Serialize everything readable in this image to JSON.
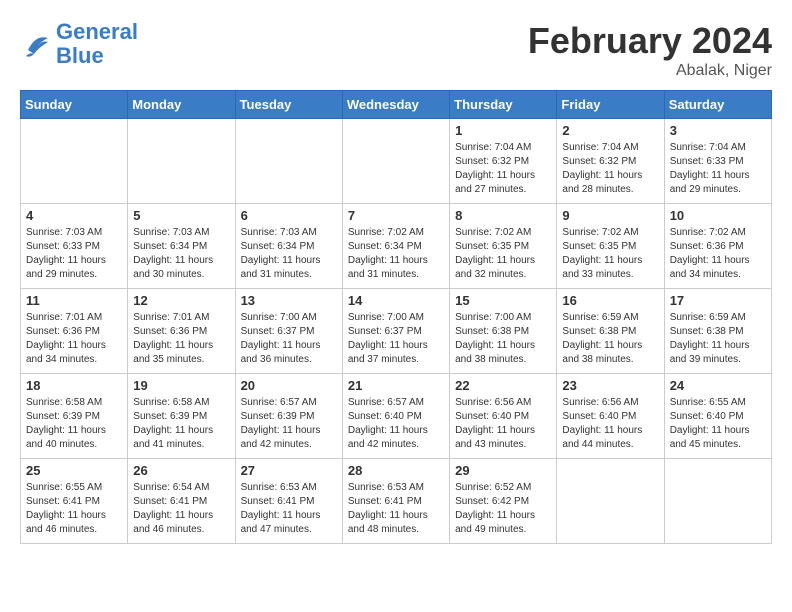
{
  "header": {
    "logo_general": "General",
    "logo_blue": "Blue",
    "month_title": "February 2024",
    "location": "Abalak, Niger"
  },
  "days_of_week": [
    "Sunday",
    "Monday",
    "Tuesday",
    "Wednesday",
    "Thursday",
    "Friday",
    "Saturday"
  ],
  "weeks": [
    {
      "days": [
        {
          "num": "",
          "empty": true
        },
        {
          "num": "",
          "empty": true
        },
        {
          "num": "",
          "empty": true
        },
        {
          "num": "",
          "empty": true
        },
        {
          "num": "1",
          "sunrise": "7:04 AM",
          "sunset": "6:32 PM",
          "daylight": "11 hours and 27 minutes."
        },
        {
          "num": "2",
          "sunrise": "7:04 AM",
          "sunset": "6:32 PM",
          "daylight": "11 hours and 28 minutes."
        },
        {
          "num": "3",
          "sunrise": "7:04 AM",
          "sunset": "6:33 PM",
          "daylight": "11 hours and 29 minutes."
        }
      ]
    },
    {
      "days": [
        {
          "num": "4",
          "sunrise": "7:03 AM",
          "sunset": "6:33 PM",
          "daylight": "11 hours and 29 minutes."
        },
        {
          "num": "5",
          "sunrise": "7:03 AM",
          "sunset": "6:34 PM",
          "daylight": "11 hours and 30 minutes."
        },
        {
          "num": "6",
          "sunrise": "7:03 AM",
          "sunset": "6:34 PM",
          "daylight": "11 hours and 31 minutes."
        },
        {
          "num": "7",
          "sunrise": "7:02 AM",
          "sunset": "6:34 PM",
          "daylight": "11 hours and 31 minutes."
        },
        {
          "num": "8",
          "sunrise": "7:02 AM",
          "sunset": "6:35 PM",
          "daylight": "11 hours and 32 minutes."
        },
        {
          "num": "9",
          "sunrise": "7:02 AM",
          "sunset": "6:35 PM",
          "daylight": "11 hours and 33 minutes."
        },
        {
          "num": "10",
          "sunrise": "7:02 AM",
          "sunset": "6:36 PM",
          "daylight": "11 hours and 34 minutes."
        }
      ]
    },
    {
      "days": [
        {
          "num": "11",
          "sunrise": "7:01 AM",
          "sunset": "6:36 PM",
          "daylight": "11 hours and 34 minutes."
        },
        {
          "num": "12",
          "sunrise": "7:01 AM",
          "sunset": "6:36 PM",
          "daylight": "11 hours and 35 minutes."
        },
        {
          "num": "13",
          "sunrise": "7:00 AM",
          "sunset": "6:37 PM",
          "daylight": "11 hours and 36 minutes."
        },
        {
          "num": "14",
          "sunrise": "7:00 AM",
          "sunset": "6:37 PM",
          "daylight": "11 hours and 37 minutes."
        },
        {
          "num": "15",
          "sunrise": "7:00 AM",
          "sunset": "6:38 PM",
          "daylight": "11 hours and 38 minutes."
        },
        {
          "num": "16",
          "sunrise": "6:59 AM",
          "sunset": "6:38 PM",
          "daylight": "11 hours and 38 minutes."
        },
        {
          "num": "17",
          "sunrise": "6:59 AM",
          "sunset": "6:38 PM",
          "daylight": "11 hours and 39 minutes."
        }
      ]
    },
    {
      "days": [
        {
          "num": "18",
          "sunrise": "6:58 AM",
          "sunset": "6:39 PM",
          "daylight": "11 hours and 40 minutes."
        },
        {
          "num": "19",
          "sunrise": "6:58 AM",
          "sunset": "6:39 PM",
          "daylight": "11 hours and 41 minutes."
        },
        {
          "num": "20",
          "sunrise": "6:57 AM",
          "sunset": "6:39 PM",
          "daylight": "11 hours and 42 minutes."
        },
        {
          "num": "21",
          "sunrise": "6:57 AM",
          "sunset": "6:40 PM",
          "daylight": "11 hours and 42 minutes."
        },
        {
          "num": "22",
          "sunrise": "6:56 AM",
          "sunset": "6:40 PM",
          "daylight": "11 hours and 43 minutes."
        },
        {
          "num": "23",
          "sunrise": "6:56 AM",
          "sunset": "6:40 PM",
          "daylight": "11 hours and 44 minutes."
        },
        {
          "num": "24",
          "sunrise": "6:55 AM",
          "sunset": "6:40 PM",
          "daylight": "11 hours and 45 minutes."
        }
      ]
    },
    {
      "days": [
        {
          "num": "25",
          "sunrise": "6:55 AM",
          "sunset": "6:41 PM",
          "daylight": "11 hours and 46 minutes."
        },
        {
          "num": "26",
          "sunrise": "6:54 AM",
          "sunset": "6:41 PM",
          "daylight": "11 hours and 46 minutes."
        },
        {
          "num": "27",
          "sunrise": "6:53 AM",
          "sunset": "6:41 PM",
          "daylight": "11 hours and 47 minutes."
        },
        {
          "num": "28",
          "sunrise": "6:53 AM",
          "sunset": "6:41 PM",
          "daylight": "11 hours and 48 minutes."
        },
        {
          "num": "29",
          "sunrise": "6:52 AM",
          "sunset": "6:42 PM",
          "daylight": "11 hours and 49 minutes."
        },
        {
          "num": "",
          "empty": true
        },
        {
          "num": "",
          "empty": true
        }
      ]
    }
  ]
}
